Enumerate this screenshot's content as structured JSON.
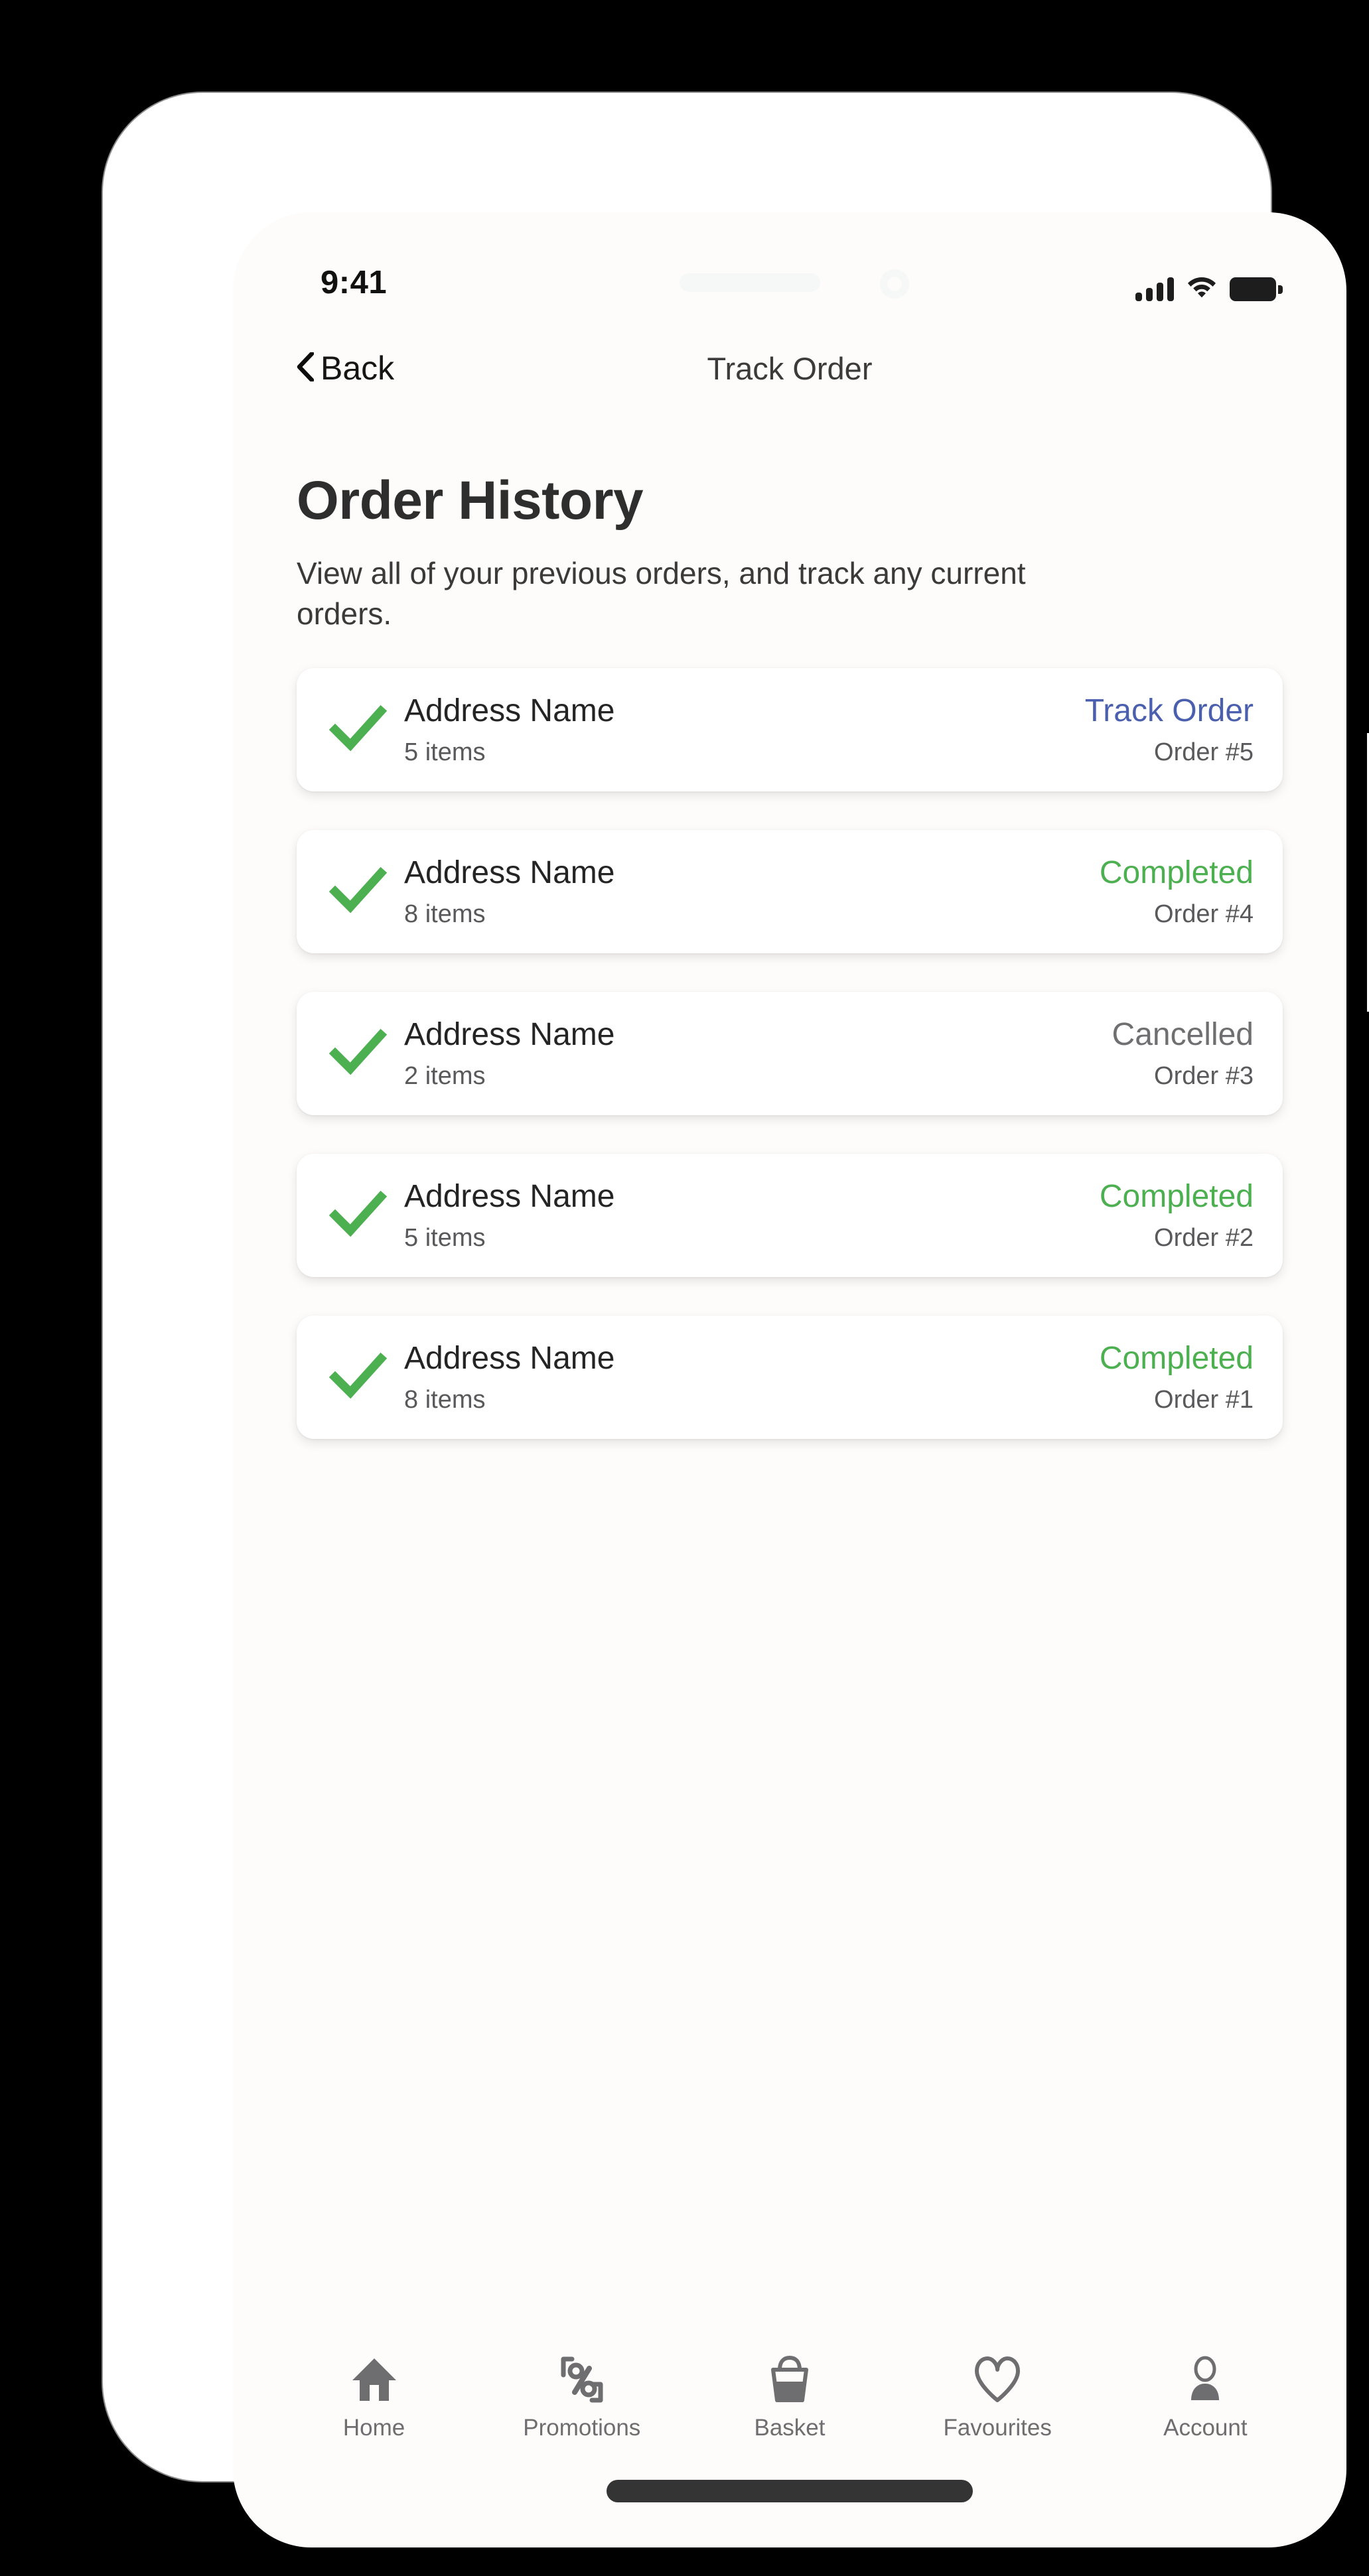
{
  "status_bar": {
    "time": "9:41",
    "icons": {
      "signal": "signal-bars-icon",
      "wifi": "wifi-icon",
      "battery": "battery-icon"
    }
  },
  "nav_header": {
    "back_label": "Back",
    "back_icon": "chevron-left-icon",
    "title": "Track Order"
  },
  "page": {
    "title": "Order History",
    "subtitle": "View all of your previous orders, and track any current orders."
  },
  "colors": {
    "accent_blue": "#4a5fad",
    "status_green": "#4caf50",
    "status_grey": "#6f6f71",
    "page_background": "#fdfcfa",
    "card_background": "#ffffff"
  },
  "orders": [
    {
      "check_icon": "green-check-icon",
      "address": "Address Name",
      "items": "5 items",
      "status": "Track Order",
      "status_kind": "track",
      "order_number": "Order #5"
    },
    {
      "check_icon": "green-check-icon",
      "address": "Address Name",
      "items": "8 items",
      "status": "Completed",
      "status_kind": "completed",
      "order_number": "Order #4"
    },
    {
      "check_icon": "green-check-icon",
      "address": "Address Name",
      "items": "2 items",
      "status": "Cancelled",
      "status_kind": "cancelled",
      "order_number": "Order #3"
    },
    {
      "check_icon": "green-check-icon",
      "address": "Address Name",
      "items": "5 items",
      "status": "Completed",
      "status_kind": "completed",
      "order_number": "Order #2"
    },
    {
      "check_icon": "green-check-icon",
      "address": "Address Name",
      "items": "8 items",
      "status": "Completed",
      "status_kind": "completed",
      "order_number": "Order #1"
    }
  ],
  "tab_bar": [
    {
      "label": "Home",
      "icon": "home-icon"
    },
    {
      "label": "Promotions",
      "icon": "percent-tag-icon"
    },
    {
      "label": "Basket",
      "icon": "basket-icon"
    },
    {
      "label": "Favourites",
      "icon": "heart-icon"
    },
    {
      "label": "Account",
      "icon": "person-icon"
    }
  ]
}
